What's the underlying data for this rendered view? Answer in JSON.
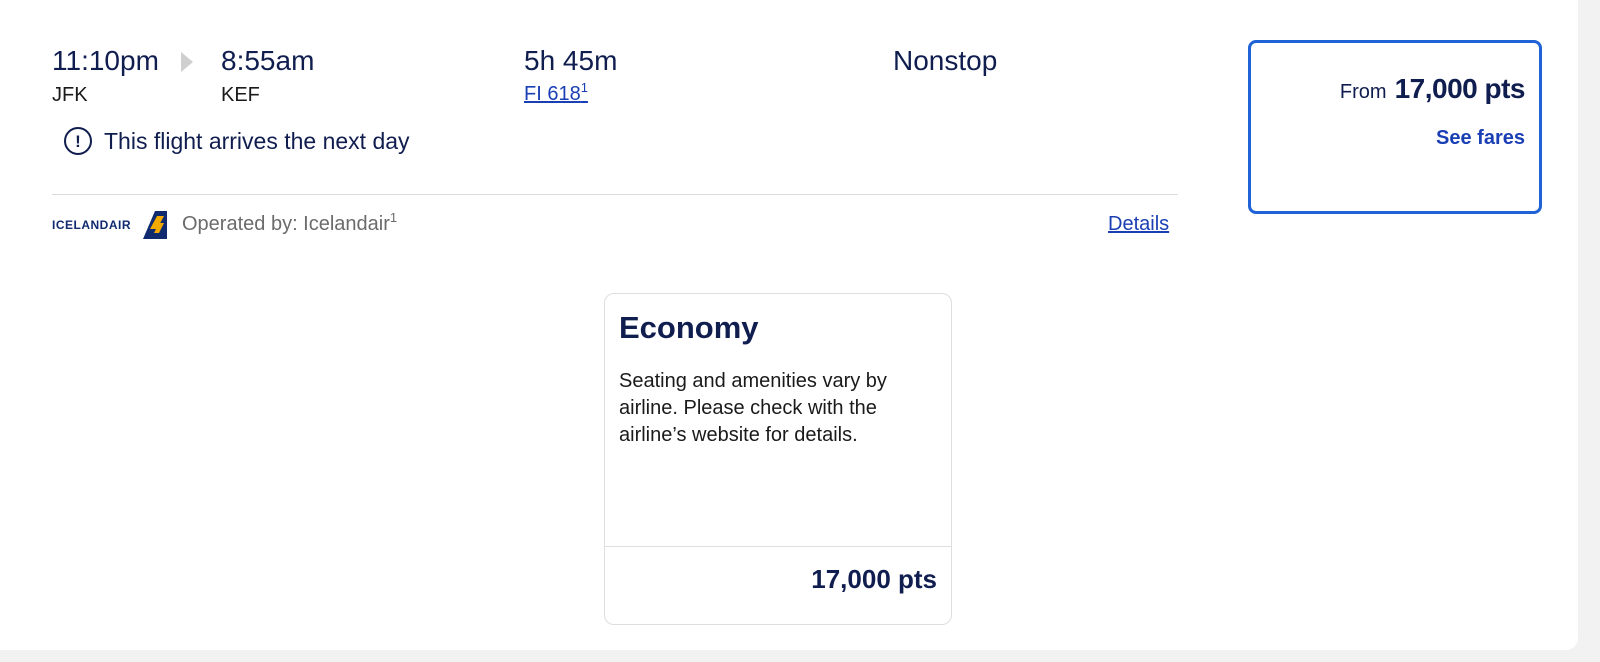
{
  "flight": {
    "depart_time": "11:10pm",
    "depart_code": "JFK",
    "arrive_time": "8:55am",
    "arrive_code": "KEF",
    "duration": "5h 45m",
    "flight_number": "FI 618",
    "flight_number_footnote": "1",
    "stops": "Nonstop",
    "notice": "This flight arrives the next day"
  },
  "operator": {
    "logo_text": "ICELANDAIR",
    "operated_by": "Operated by: Icelandair",
    "footnote": "1",
    "details_label": "Details"
  },
  "price_box": {
    "from_label": "From",
    "from_price": "17,000 pts",
    "see_fares_label": "See fares"
  },
  "fare_card": {
    "title": "Economy",
    "description": "Seating and amenities vary by airline. Please check with the airline’s website for details.",
    "price": "17,000 pts"
  },
  "colors": {
    "primary_text": "#101d4f",
    "link": "#1a3fb4",
    "selected_border": "#1f63d6",
    "logo_tail_blue": "#0f2a6e",
    "logo_tail_gold": "#f2a900"
  }
}
